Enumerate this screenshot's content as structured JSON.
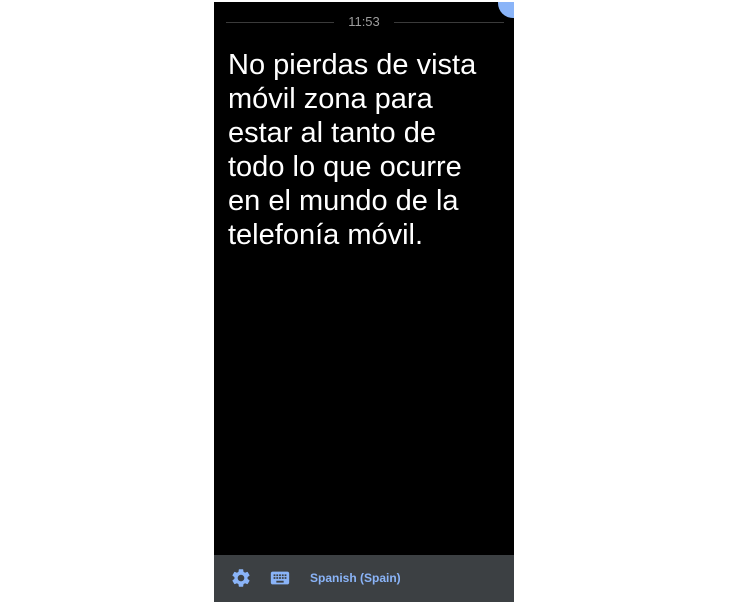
{
  "status": {
    "time": "11:53"
  },
  "transcript": {
    "text": "No pierdas de vista móvil zona para estar al tanto de todo lo que ocurre en el mundo de la telefonía móvil."
  },
  "bottom_bar": {
    "settings_icon": "gear-icon",
    "keyboard_icon": "keyboard-icon",
    "language_label": "Spanish (Spain)"
  },
  "colors": {
    "background": "#000000",
    "text": "#ffffff",
    "accent": "#8ab4f8",
    "bar_background": "#3c4043",
    "time_text": "#9e9e9e"
  }
}
